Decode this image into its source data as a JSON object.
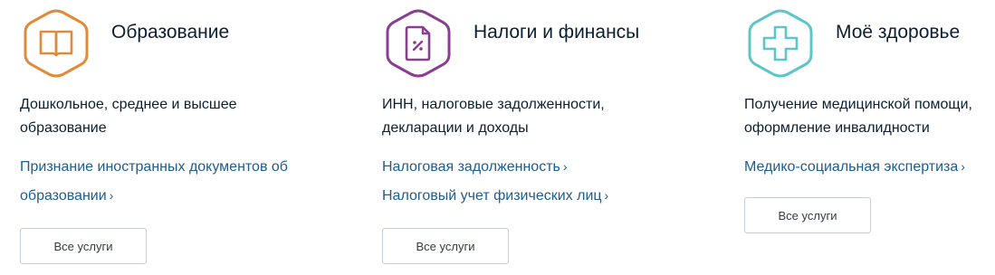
{
  "cards": [
    {
      "title": "Образование",
      "description": "Дошкольное, среднее и высшее образование",
      "icon": "book-icon",
      "color": "#e08a3a",
      "links": [
        {
          "text": "Признание иностранных документов об",
          "text2": "образовании",
          "chevron": "›"
        }
      ],
      "button": "Все услуги"
    },
    {
      "title": "Налоги и финансы",
      "description": "ИНН, налоговые задолженности, декларации и доходы",
      "icon": "tax-document-icon",
      "color": "#8a3e8f",
      "links": [
        {
          "text": "Налоговая задолженность",
          "chevron": "›"
        },
        {
          "text": "Налоговый учет физических лиц",
          "chevron": "›"
        }
      ],
      "button": "Все услуги"
    },
    {
      "title": "Моё здоровье",
      "description": "Получение медицинской помощи, оформление инвалидности",
      "icon": "medical-cross-icon",
      "color": "#5ec6c9",
      "links": [
        {
          "text": "Медико-социальная экспертиза",
          "chevron": "›"
        }
      ],
      "button": "Все услуги"
    }
  ]
}
